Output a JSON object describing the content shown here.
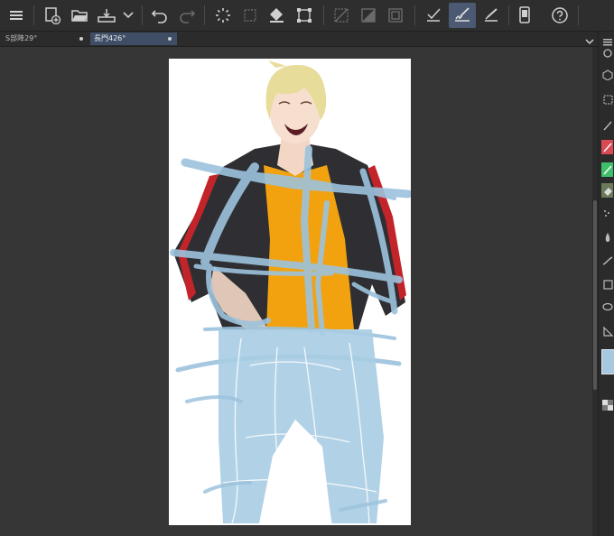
{
  "tabs": [
    {
      "label": "S部降29°",
      "active": false
    },
    {
      "label": "長門426°",
      "active": true
    }
  ],
  "toolbar": {
    "buttons": [
      {
        "name": "menu-icon",
        "active": false
      },
      {
        "name": "new-file-icon",
        "active": false
      },
      {
        "name": "open-folder-icon",
        "active": false
      },
      {
        "name": "save-icon",
        "active": false
      },
      {
        "name": "chevron-down-icon",
        "active": false
      },
      {
        "name": "undo-icon",
        "active": false
      },
      {
        "name": "redo-icon",
        "active": false
      },
      {
        "name": "loading-spinner-icon",
        "active": false
      },
      {
        "name": "clear-icon",
        "active": false
      },
      {
        "name": "fill-icon",
        "active": false
      },
      {
        "name": "transform-icon",
        "active": false
      },
      {
        "name": "deselect-icon",
        "active": false
      },
      {
        "name": "invert-selection-icon",
        "active": false
      },
      {
        "name": "selection-border-icon",
        "active": false
      },
      {
        "name": "pen-check-icon",
        "active": false
      },
      {
        "name": "brush-icon",
        "active": true
      },
      {
        "name": "eraser-pen-icon",
        "active": false
      },
      {
        "name": "smartphone-icon",
        "active": false
      },
      {
        "name": "help-icon",
        "active": false
      }
    ]
  },
  "colors": {
    "accent": "#4b5a72",
    "sketch": "#9cc3dd",
    "jacket": "#2f2f33",
    "shirt": "#f2a20f",
    "hair": "#e8dc9a"
  }
}
